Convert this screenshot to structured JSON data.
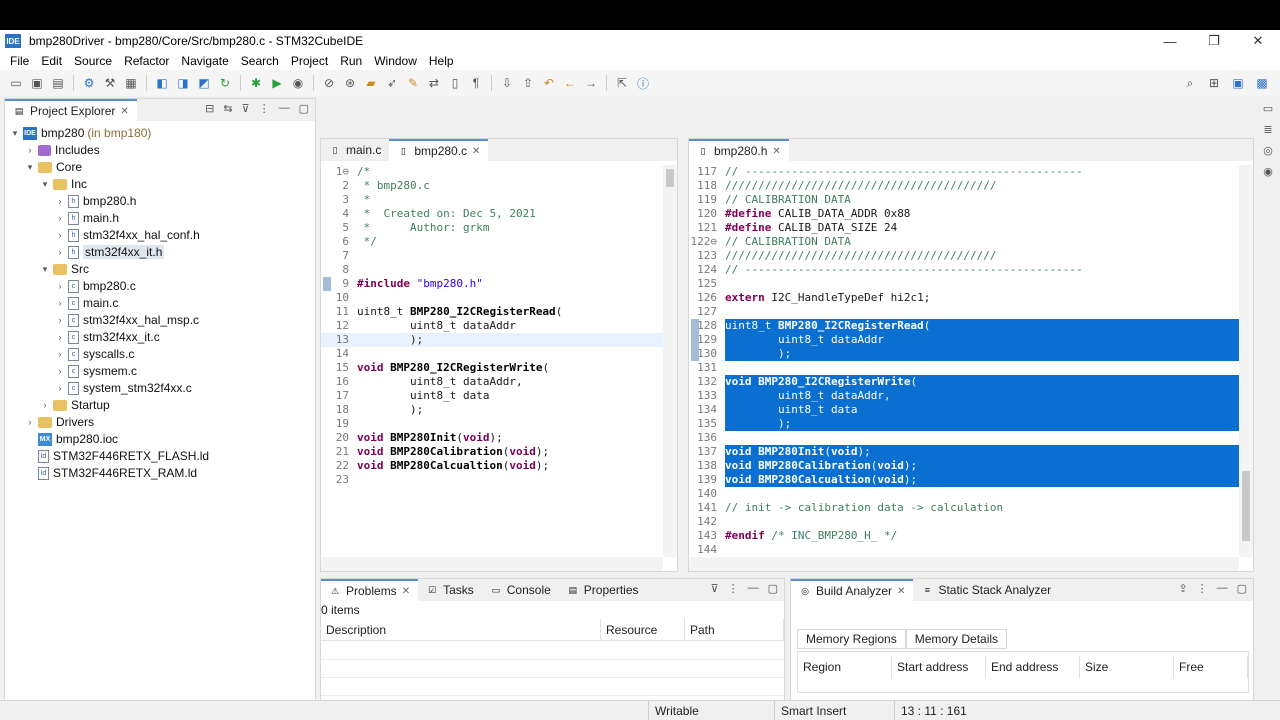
{
  "window": {
    "app_icon_text": "IDE",
    "title": "bmp280Driver - bmp280/Core/Src/bmp280.c - STM32CubeIDE",
    "minimize": "—",
    "restore": "❐",
    "close": "✕"
  },
  "menu": [
    "File",
    "Edit",
    "Source",
    "Refactor",
    "Navigate",
    "Search",
    "Project",
    "Run",
    "Window",
    "Help"
  ],
  "explorer": {
    "tab_label": "Project Explorer",
    "tree": [
      {
        "label": "bmp280",
        "extra": "(in bmp180)",
        "icon": "proj",
        "icon_text": "IDE",
        "depth": 0,
        "arrow": "▾"
      },
      {
        "label": "Includes",
        "icon": "inc",
        "depth": 1,
        "arrow": "›"
      },
      {
        "label": "Core",
        "icon": "folder",
        "depth": 1,
        "arrow": "▾"
      },
      {
        "label": "Inc",
        "icon": "folder",
        "depth": 2,
        "arrow": "▾"
      },
      {
        "label": "bmp280.h",
        "icon": "file",
        "icon_text": "h",
        "depth": 3,
        "arrow": "›"
      },
      {
        "label": "main.h",
        "icon": "file",
        "icon_text": "h",
        "depth": 3,
        "arrow": "›"
      },
      {
        "label": "stm32f4xx_hal_conf.h",
        "icon": "file",
        "icon_text": "h",
        "depth": 3,
        "arrow": "›"
      },
      {
        "label": "stm32f4xx_it.h",
        "icon": "file",
        "icon_text": "h",
        "depth": 3,
        "arrow": "›",
        "selected": true
      },
      {
        "label": "Src",
        "icon": "folder",
        "depth": 2,
        "arrow": "▾"
      },
      {
        "label": "bmp280.c",
        "icon": "file",
        "icon_text": "c",
        "depth": 3,
        "arrow": "›"
      },
      {
        "label": "main.c",
        "icon": "file",
        "icon_text": "c",
        "depth": 3,
        "arrow": "›"
      },
      {
        "label": "stm32f4xx_hal_msp.c",
        "icon": "file",
        "icon_text": "c",
        "depth": 3,
        "arrow": "›"
      },
      {
        "label": "stm32f4xx_it.c",
        "icon": "file",
        "icon_text": "c",
        "depth": 3,
        "arrow": "›"
      },
      {
        "label": "syscalls.c",
        "icon": "file",
        "icon_text": "c",
        "depth": 3,
        "arrow": "›"
      },
      {
        "label": "sysmem.c",
        "icon": "file",
        "icon_text": "c",
        "depth": 3,
        "arrow": "›"
      },
      {
        "label": "system_stm32f4xx.c",
        "icon": "file",
        "icon_text": "c",
        "depth": 3,
        "arrow": "›"
      },
      {
        "label": "Startup",
        "icon": "folder",
        "depth": 2,
        "arrow": "›"
      },
      {
        "label": "Drivers",
        "icon": "folder",
        "depth": 1,
        "arrow": "›"
      },
      {
        "label": "bmp280.ioc",
        "icon": "mx",
        "icon_text": "MX",
        "depth": 1,
        "arrow": ""
      },
      {
        "label": "STM32F446RETX_FLASH.ld",
        "icon": "file",
        "icon_text": "ld",
        "depth": 1,
        "arrow": ""
      },
      {
        "label": "STM32F446RETX_RAM.ld",
        "icon": "file",
        "icon_text": "ld",
        "depth": 1,
        "arrow": ""
      }
    ]
  },
  "editor_left": {
    "tabs": [
      {
        "label": "main.c",
        "active": false
      },
      {
        "label": "bmp280.c",
        "active": true,
        "close": "✕"
      }
    ],
    "lines": [
      {
        "n": "1⊖",
        "parts": [
          [
            "cm",
            "/*"
          ]
        ]
      },
      {
        "n": "2",
        "parts": [
          [
            "cm",
            " * bmp280.c"
          ]
        ]
      },
      {
        "n": "3",
        "parts": [
          [
            "cm",
            " *"
          ]
        ]
      },
      {
        "n": "4",
        "parts": [
          [
            "cm",
            " *  Created on: Dec 5, 2021"
          ]
        ]
      },
      {
        "n": "5",
        "parts": [
          [
            "cm",
            " *      Author: grkm"
          ]
        ]
      },
      {
        "n": "6",
        "parts": [
          [
            "cm",
            " */"
          ]
        ]
      },
      {
        "n": "7",
        "parts": []
      },
      {
        "n": "8",
        "parts": []
      },
      {
        "n": "9",
        "parts": [
          [
            "kw",
            "#include"
          ],
          [
            "",
            " "
          ],
          [
            "st",
            "\"bmp280.h\""
          ]
        ]
      },
      {
        "n": "10",
        "parts": []
      },
      {
        "n": "11",
        "parts": [
          [
            "",
            "uint8_t "
          ],
          [
            "fn",
            "BMP280_I2CRegisterRead"
          ],
          [
            "",
            "("
          ]
        ]
      },
      {
        "n": "12",
        "parts": [
          [
            "",
            "        uint8_t dataAddr"
          ]
        ]
      },
      {
        "n": "13",
        "parts": [
          [
            "",
            "        );"
          ]
        ]
      },
      {
        "n": "14",
        "parts": []
      },
      {
        "n": "15",
        "parts": [
          [
            "kw",
            "void"
          ],
          [
            "",
            " "
          ],
          [
            "fn",
            "BMP280_I2CRegisterWrite"
          ],
          [
            "",
            "("
          ]
        ]
      },
      {
        "n": "16",
        "parts": [
          [
            "",
            "        uint8_t dataAddr,"
          ]
        ]
      },
      {
        "n": "17",
        "parts": [
          [
            "",
            "        uint8_t data"
          ]
        ]
      },
      {
        "n": "18",
        "parts": [
          [
            "",
            "        );"
          ]
        ]
      },
      {
        "n": "19",
        "parts": []
      },
      {
        "n": "20",
        "parts": [
          [
            "kw",
            "void"
          ],
          [
            "",
            " "
          ],
          [
            "fn",
            "BMP280Init"
          ],
          [
            "",
            "("
          ],
          [
            "kw",
            "void"
          ],
          [
            "",
            ");"
          ]
        ]
      },
      {
        "n": "21",
        "parts": [
          [
            "kw",
            "void"
          ],
          [
            "",
            " "
          ],
          [
            "fn",
            "BMP280Calibration"
          ],
          [
            "",
            "("
          ],
          [
            "kw",
            "void"
          ],
          [
            "",
            ");"
          ]
        ]
      },
      {
        "n": "22",
        "parts": [
          [
            "kw",
            "void"
          ],
          [
            "",
            " "
          ],
          [
            "fn",
            "BMP280Calcualtion"
          ],
          [
            "",
            "("
          ],
          [
            "kw",
            "void"
          ],
          [
            "",
            ");"
          ]
        ]
      },
      {
        "n": "23",
        "parts": []
      }
    ]
  },
  "editor_right": {
    "tabs": [
      {
        "label": "bmp280.h",
        "active": true,
        "close": "✕"
      }
    ],
    "lines": [
      {
        "n": "117",
        "parts": [
          [
            "cm",
            "// ---------------------------------------------------"
          ]
        ]
      },
      {
        "n": "118",
        "parts": [
          [
            "cm",
            "/////////////////////////////////////////"
          ]
        ]
      },
      {
        "n": "119",
        "parts": [
          [
            "cm",
            "// CALIBRATION DATA"
          ]
        ]
      },
      {
        "n": "120",
        "parts": [
          [
            "kw",
            "#define"
          ],
          [
            "",
            " CALIB_DATA_ADDR 0x88"
          ]
        ]
      },
      {
        "n": "121",
        "parts": [
          [
            "kw",
            "#define"
          ],
          [
            "",
            " CALIB_DATA_SIZE 24"
          ]
        ]
      },
      {
        "n": "122⊖",
        "parts": [
          [
            "cm",
            "// CALIBRATION DATA"
          ]
        ]
      },
      {
        "n": "123",
        "parts": [
          [
            "cm",
            "/////////////////////////////////////////"
          ]
        ]
      },
      {
        "n": "124",
        "parts": [
          [
            "cm",
            "// ---------------------------------------------------"
          ]
        ]
      },
      {
        "n": "125",
        "parts": []
      },
      {
        "n": "126",
        "parts": [
          [
            "kw",
            "extern"
          ],
          [
            "",
            " I2C_HandleTypeDef hi2c1;"
          ]
        ]
      },
      {
        "n": "127",
        "parts": []
      },
      {
        "n": "128",
        "hl": true,
        "parts": [
          [
            "",
            "uint8_t "
          ],
          [
            "fn",
            "BMP280_I2CRegisterRead"
          ],
          [
            "",
            "("
          ]
        ]
      },
      {
        "n": "129",
        "hl": true,
        "parts": [
          [
            "",
            "        uint8_t dataAddr"
          ]
        ]
      },
      {
        "n": "130",
        "hl": true,
        "parts": [
          [
            "",
            "        );"
          ]
        ]
      },
      {
        "n": "131",
        "hl": true,
        "parts": []
      },
      {
        "n": "132",
        "hl": true,
        "parts": [
          [
            "kw",
            "void"
          ],
          [
            "",
            " "
          ],
          [
            "fn",
            "BMP280_I2CRegisterWrite"
          ],
          [
            "",
            "("
          ]
        ]
      },
      {
        "n": "133",
        "hl": true,
        "parts": [
          [
            "",
            "        uint8_t dataAddr,"
          ]
        ]
      },
      {
        "n": "134",
        "hl": true,
        "parts": [
          [
            "",
            "        uint8_t data"
          ]
        ]
      },
      {
        "n": "135",
        "hl": true,
        "parts": [
          [
            "",
            "        );"
          ]
        ]
      },
      {
        "n": "136",
        "hl": true,
        "parts": []
      },
      {
        "n": "137",
        "hl": true,
        "parts": [
          [
            "kw",
            "void"
          ],
          [
            "",
            " "
          ],
          [
            "fn",
            "BMP280Init"
          ],
          [
            "",
            "("
          ],
          [
            "kw",
            "void"
          ],
          [
            "",
            ");"
          ]
        ]
      },
      {
        "n": "138",
        "hl": true,
        "parts": [
          [
            "kw",
            "void"
          ],
          [
            "",
            " "
          ],
          [
            "fn",
            "BMP280Calibration"
          ],
          [
            "",
            "("
          ],
          [
            "kw",
            "void"
          ],
          [
            "",
            ");"
          ]
        ]
      },
      {
        "n": "139",
        "hl": true,
        "parts": [
          [
            "kw",
            "void"
          ],
          [
            "",
            " "
          ],
          [
            "fn",
            "BMP280Calcualtion"
          ],
          [
            "",
            "("
          ],
          [
            "kw",
            "void"
          ],
          [
            "",
            ");"
          ]
        ]
      },
      {
        "n": "140",
        "parts": []
      },
      {
        "n": "141",
        "parts": [
          [
            "cm",
            "// init -> calibration data -> calculation"
          ]
        ]
      },
      {
        "n": "142",
        "parts": []
      },
      {
        "n": "143",
        "parts": [
          [
            "kw",
            "#endif"
          ],
          [
            "",
            " "
          ],
          [
            "cm",
            "/* INC_BMP280_H_ */"
          ]
        ]
      },
      {
        "n": "144",
        "parts": []
      }
    ]
  },
  "problems": {
    "tabs": [
      "Problems",
      "Tasks",
      "Console",
      "Properties"
    ],
    "count": "0 items",
    "columns": [
      "Description",
      "Resource",
      "Path"
    ]
  },
  "build": {
    "tabs": [
      "Build Analyzer",
      "Static Stack Analyzer"
    ],
    "subtabs": [
      "Memory Regions",
      "Memory Details"
    ],
    "columns": [
      "Region",
      "Start address",
      "End address",
      "Size",
      "Free"
    ]
  },
  "status": {
    "writable": "Writable",
    "insert_mode": "Smart Insert",
    "position": "13 : 11 : 161"
  },
  "colors": {
    "selection": "#0a6fd1",
    "keyword": "#7f0055",
    "comment": "#3f7f5f",
    "string": "#2a00ff"
  }
}
